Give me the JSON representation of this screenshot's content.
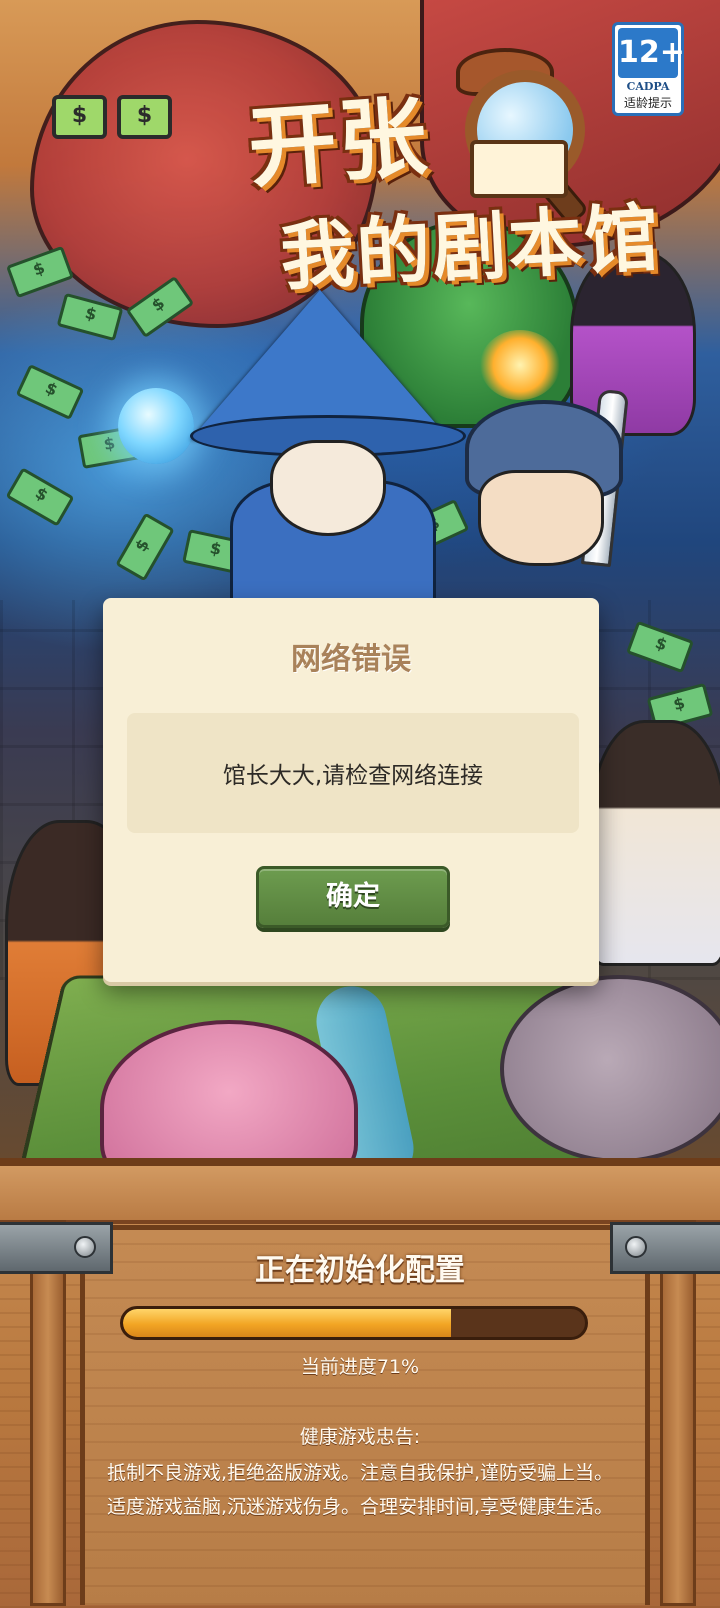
{
  "logo": {
    "line1": "开张",
    "line2": "我的剧本馆"
  },
  "age_rating": {
    "age": "12+",
    "org": "CADPA",
    "tip": "适龄提示"
  },
  "dialog": {
    "title": "网络错误",
    "message": "馆长大大,请检查网络连接",
    "confirm_label": "确定"
  },
  "loading": {
    "title": "正在初始化配置",
    "progress": 0.71,
    "progress_text": "当前进度71%"
  },
  "health_notice": {
    "title": "健康游戏忠告:",
    "line1": "抵制不良游戏,拒绝盗版游戏。注意自我保护,谨防受骗上当。",
    "line2": "适度游戏益脑,沉迷游戏伤身。合理安排时间,享受健康生活。"
  },
  "icons": {
    "money_bill": "dollar-bill-icon",
    "magnifier": "magnifier-icon",
    "book": "book-icon"
  },
  "colors": {
    "confirm_green": "#567f3b",
    "progress_orange": "#f2a524",
    "dialog_bg": "#f8efd6",
    "wood": "#b9793f"
  }
}
